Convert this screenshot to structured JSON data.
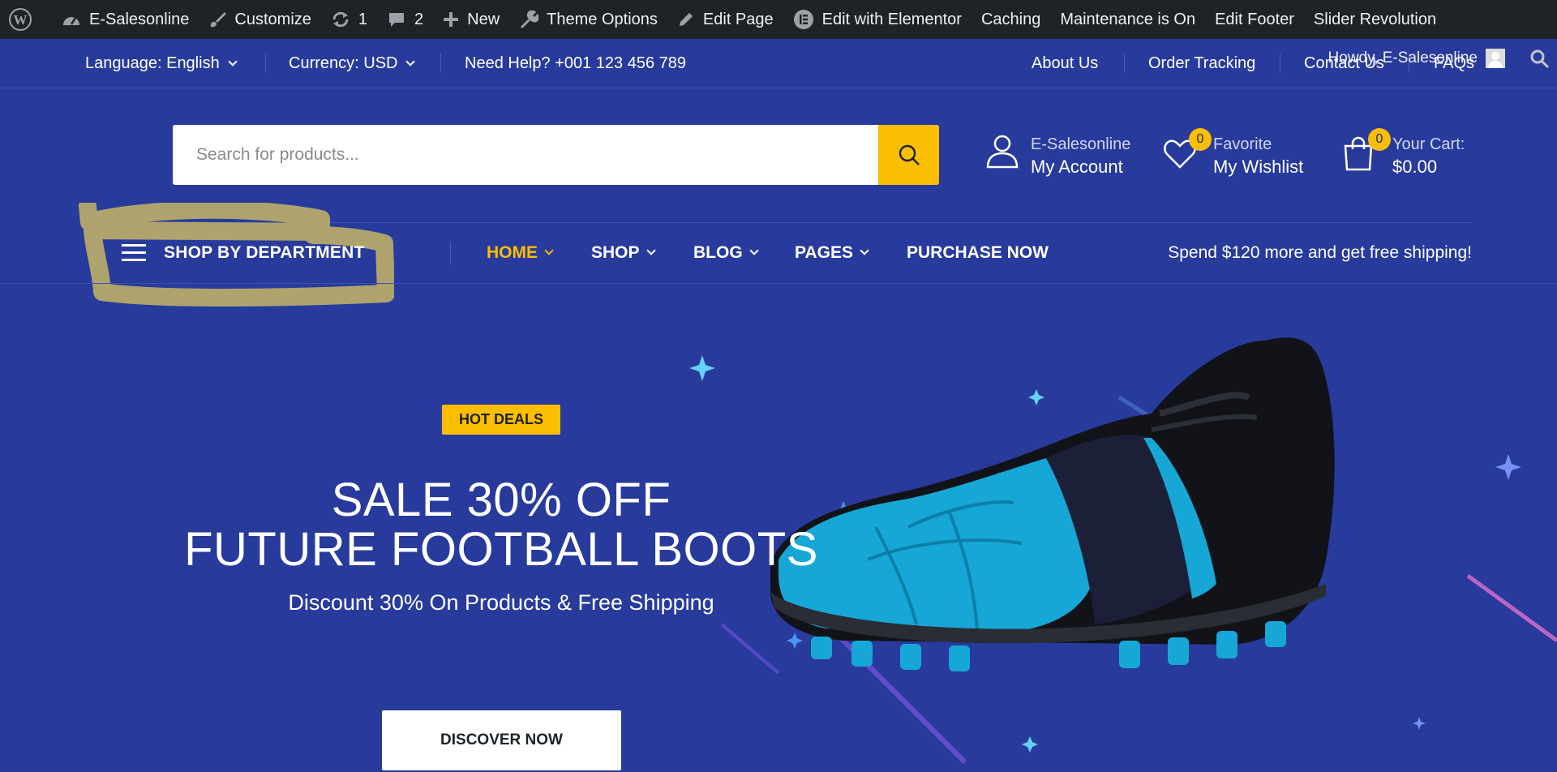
{
  "adminbar": {
    "site_name": "E-Salesonline",
    "customize": "Customize",
    "updates_count": "1",
    "comments_count": "2",
    "new": "New",
    "theme_options": "Theme Options",
    "edit_page": "Edit Page",
    "edit_elementor": "Edit with Elementor",
    "caching": "Caching",
    "maintenance": "Maintenance is On",
    "edit_footer": "Edit Footer",
    "slider_revolution": "Slider Revolution",
    "howdy": "Howdy, E-Salesonline"
  },
  "topbar": {
    "language": "Language: English",
    "currency": "Currency: USD",
    "help": "Need Help? +001 123 456 789",
    "links": [
      "About Us",
      "Order Tracking",
      "Contact Us",
      "FAQs"
    ]
  },
  "header": {
    "search_placeholder": "Search for products...",
    "account_small": "E-Salesonline",
    "account_big": "My Account",
    "wishlist_small": "Favorite",
    "wishlist_big": "My Wishlist",
    "wishlist_count": "0",
    "cart_small": "Your Cart:",
    "cart_big": "$0.00",
    "cart_count": "0"
  },
  "nav": {
    "department": "SHOP BY DEPARTMENT",
    "items": [
      "HOME",
      "SHOP",
      "BLOG",
      "PAGES",
      "PURCHASE NOW"
    ],
    "promo": "Spend $120 more and get free shipping!"
  },
  "hero": {
    "badge": "HOT DEALS",
    "title_line1": "SALE 30% OFF",
    "title_line2": "FUTURE FOOTBALL BOOTS",
    "subtitle": "Discount 30% On Products & Free Shipping",
    "button": "DISCOVER NOW"
  },
  "colors": {
    "background": "#283b9c",
    "accent": "#fcbe00",
    "adminbar": "#1d2327"
  },
  "icons": [
    "wordpress-icon",
    "dashboard-icon",
    "brush-icon",
    "updates-icon",
    "comment-icon",
    "plus-icon",
    "wrench-icon",
    "pencil-icon",
    "elementor-icon",
    "search-icon",
    "user-icon",
    "heart-icon",
    "bag-icon",
    "hamburger-icon"
  ]
}
